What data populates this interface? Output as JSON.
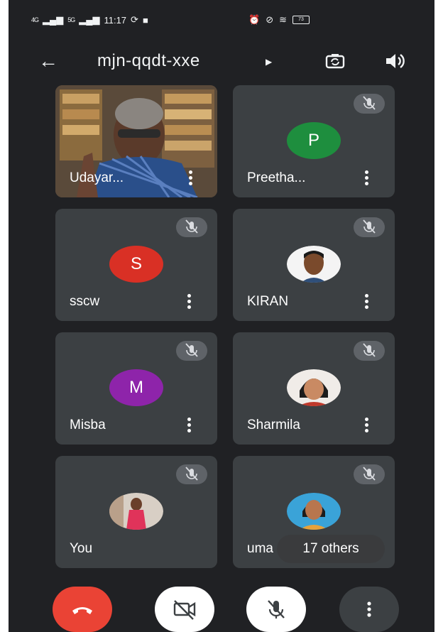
{
  "status_bar": {
    "time": "11:17",
    "signal_1": "4G",
    "signal_2": "5G",
    "battery": "73"
  },
  "header": {
    "meeting_code": "mjn-qqdt-xxe"
  },
  "participants": [
    {
      "name": "Udayar...",
      "initial": "",
      "avatar_color": "",
      "video": true
    },
    {
      "name": "Preetha...",
      "initial": "P",
      "avatar_color": "#1e8e3e",
      "muted": true
    },
    {
      "name": "sscw",
      "initial": "S",
      "avatar_color": "#d93025",
      "muted": true
    },
    {
      "name": "KIRAN",
      "initial": "",
      "avatar_color": "",
      "muted": true
    },
    {
      "name": "Misba",
      "initial": "M",
      "avatar_color": "#8e24aa",
      "muted": true
    },
    {
      "name": "Sharmila",
      "initial": "",
      "avatar_color": "",
      "muted": true
    },
    {
      "name": "You",
      "initial": "",
      "avatar_color": "",
      "muted": true
    },
    {
      "name": "uma",
      "initial": "",
      "avatar_color": "",
      "muted": true
    }
  ],
  "others_pill": "17 others",
  "controls": {
    "end_call_color": "#ea4335"
  },
  "icons": [
    "back-arrow-icon",
    "switch-camera-icon",
    "speaker-icon",
    "mic-off-icon",
    "more-vert-icon",
    "call-end-icon",
    "camera-off-icon"
  ]
}
